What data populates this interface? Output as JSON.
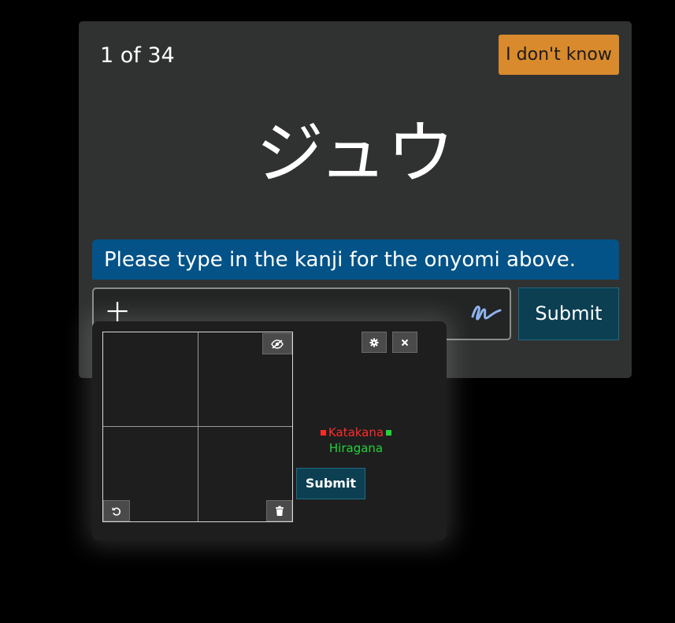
{
  "quiz": {
    "progress": "1 of 34",
    "idk_label": "I don't know",
    "reading": "ジュウ",
    "instruction": "Please type in the kanji for the onyomi above.",
    "answer_value": "十",
    "submit_label": "Submit"
  },
  "handwriting": {
    "legend_katakana": "Katakana",
    "legend_hiragana": "Hiragana",
    "submit_label": "Submit",
    "icons": [
      "eye-slash-icon",
      "gear-icon",
      "close-icon",
      "undo-icon",
      "trash-icon",
      "handwriting-icon"
    ]
  },
  "colors": {
    "idk_button": "#d98a2c",
    "instruction_bar": "#035388",
    "submit_button": "#0c3f52",
    "katakana": "#ff2a2a",
    "hiragana": "#22d33a",
    "handwriting_icon": "#8fb4f0"
  }
}
